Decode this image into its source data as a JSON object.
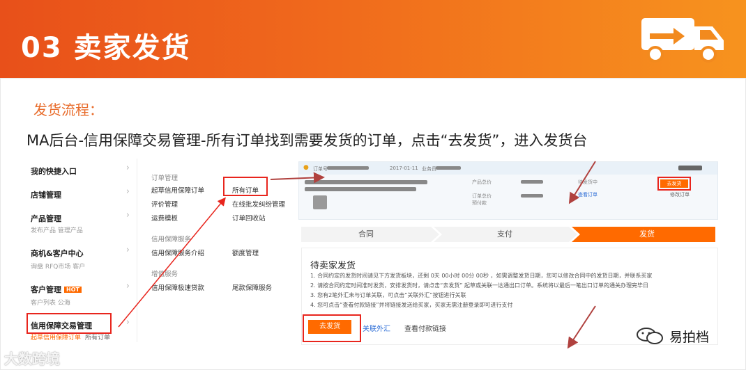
{
  "banner": {
    "title": "03 卖家发货"
  },
  "subtitle": "发货流程：",
  "description": "MA后台-信用保障交易管理-所有订单找到需要发货的订单，点击“去发货”，进入发货台",
  "menu": {
    "items": [
      {
        "label": "我的快捷入口"
      },
      {
        "label": "店铺管理"
      },
      {
        "label": "产品管理",
        "sub": "发布产品   管理产品"
      },
      {
        "label": "商机&客户中心",
        "sub": "询盘   RFQ市场   客户"
      },
      {
        "label": "客户管理",
        "badge": "HOT",
        "sub": "客户列表   公海"
      },
      {
        "label": "信用保障交易管理"
      }
    ],
    "bottom_links": [
      "起草信用保障订单",
      "所有订单"
    ]
  },
  "submenu": {
    "group1": "订单管理",
    "draft": "起草信用保障订单",
    "all_orders": "所有订单",
    "eval": "评价管理",
    "dispute": "在线批发纠纷管理",
    "ship_tpl": "运费模板",
    "recycle": "订单回收站",
    "group2": "信用保障服务",
    "intro": "信用保障服务介绍",
    "quota": "额度管理",
    "group3": "增值服务",
    "fast_loan": "信用保障极速贷款",
    "tail": "尾款保障服务"
  },
  "order": {
    "head_no": "订单号",
    "head_date": "2017-01-11",
    "head_biz": "业务员",
    "col_amount": "产品总价",
    "col_contract": "订单总价",
    "col_pay": "预付款",
    "pending": "待发货中",
    "view_order": "查看订单",
    "ship_btn": "去发货",
    "modify": "修改订单"
  },
  "steps": [
    "合同",
    "支付",
    "发货"
  ],
  "ship_panel": {
    "title": "待卖家发货",
    "notes": [
      "1. 合同约定的发货时间请见下方发货板块，还剩 0天 00小时 00分 00秒 ，如需调整发货日期，您可以修改合同中的发货日期，并联系买家",
      "2. 请按合同约定时间准时发货，安排发货时，请点击“去发货” 起草或关联一达通出口订单。系统将以最后一笔出口订单的通关办理完毕日",
      "3. 您有2笔外汇未与订单关联，可点击“关联外汇”按钮进行关联",
      "4. 您可点击“查看付款链接”并将链接发送给买家，买家无需注册登录即可进行支付"
    ],
    "go_ship": "去发货",
    "link_fx": "关联外汇",
    "link_pay": "查看付款链接"
  },
  "watermark_left": "大数跨境",
  "watermark_right": "易拍档",
  "colors": {
    "brand_orange": "#ff6a00",
    "red_box": "#e8251d",
    "banner_start": "#e8501a",
    "banner_end": "#f7931e"
  }
}
